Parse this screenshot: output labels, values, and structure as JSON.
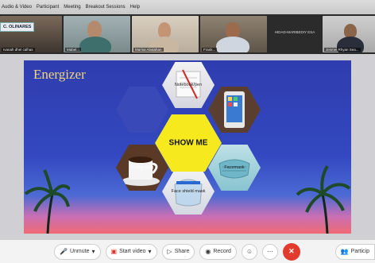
{
  "menu": [
    "Audio & Video",
    "Participant",
    "Meeting",
    "Breakout Sessions",
    "Help"
  ],
  "participants": [
    {
      "badge": "C. OLINARES",
      "name": "Mabel..."
    },
    {
      "name": "Ivanah dhel calhas"
    },
    {
      "name": "Marisa Abalahan"
    },
    {
      "name": "Frank..."
    },
    {
      "center_text": "HIDAD-MARIBEDIY ESA",
      "name": ""
    },
    {
      "name": "Jesmel Rhyan Sea..."
    }
  ],
  "slide": {
    "title": "Energizer",
    "center_label": "SHOW ME",
    "items": [
      {
        "label": "Notebook/pen",
        "icon": "notebook-pen-image"
      },
      {
        "label": "",
        "icon": "smartphone-image"
      },
      {
        "label": "Facemask",
        "icon": "facemask-image"
      },
      {
        "label": "Face shield mask",
        "icon": "face-shield-image"
      },
      {
        "label": "Coffee mug",
        "icon": "coffee-mug-image"
      },
      {
        "label": "",
        "icon": "blank-hexagon"
      }
    ]
  },
  "controls": {
    "unmute": "Unmute",
    "start_video": "Start video",
    "share": "Share",
    "record": "Record",
    "participants": "Particip"
  }
}
